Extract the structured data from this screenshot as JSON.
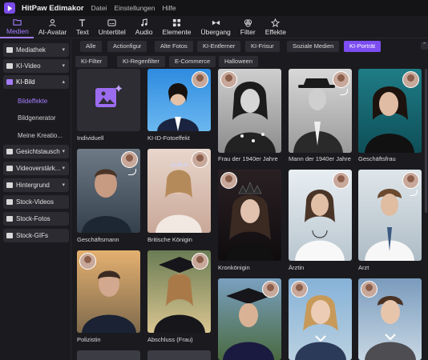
{
  "app": {
    "name": "HitPaw Edimakor",
    "menu": [
      "Datei",
      "Einstellungen",
      "Hilfe"
    ]
  },
  "toolbar": [
    {
      "label": "Medien",
      "icon": "media-folder-icon",
      "active": true
    },
    {
      "label": "AI-Avatar",
      "icon": "avatar-icon"
    },
    {
      "label": "Text",
      "icon": "text-icon"
    },
    {
      "label": "Untertitel",
      "icon": "subtitle-icon"
    },
    {
      "label": "Audio",
      "icon": "music-note-icon"
    },
    {
      "label": "Elemente",
      "icon": "elements-grid-icon"
    },
    {
      "label": "Übergang",
      "icon": "transition-icon"
    },
    {
      "label": "Filter",
      "icon": "filter-icon"
    },
    {
      "label": "Effekte",
      "icon": "effects-star-icon"
    }
  ],
  "sidebar": {
    "items": [
      {
        "label": "Mediathek",
        "icon": "library-icon"
      },
      {
        "label": "KI-Video",
        "icon": "video-icon"
      },
      {
        "label": "KI-Bild",
        "icon": "image-icon",
        "active": true
      },
      {
        "label": "Gesichtstausch",
        "icon": "face-swap-icon"
      },
      {
        "label": "Videoverstärk...",
        "icon": "enhance-icon"
      },
      {
        "label": "Hintergrund",
        "icon": "background-icon"
      },
      {
        "label": "Stock-Videos",
        "icon": "stock-video-icon"
      },
      {
        "label": "Stock-Fotos",
        "icon": "stock-photo-icon"
      },
      {
        "label": "Stock-GIFs",
        "icon": "stock-gif-icon"
      }
    ],
    "subitems": [
      {
        "label": "Bildeffekte",
        "active": true
      },
      {
        "label": "Bildgenerator"
      },
      {
        "label": "Meine Kreatio..."
      }
    ]
  },
  "filters": {
    "row1": [
      "Alle",
      "Actionfigur",
      "Alte Fotos",
      "KI-Entferner",
      "KI-Frisur",
      "Soziale Medien",
      "KI-Porträt"
    ],
    "row2": [
      "KI-Filter",
      "KI-Regenfilter",
      "E-Commerce",
      "Halloween"
    ],
    "active": "KI-Porträt"
  },
  "grid": {
    "col1": [
      "Individuell",
      "Geschäftsmann",
      "Polizistin"
    ],
    "col2": [
      "KI-ID-Fotoeffekt",
      "Britische Königin",
      "Abschluss (Frau)"
    ],
    "col3": [
      "Frau der 1940er Jahre",
      "Kronkönigin"
    ],
    "col4": [
      "Mann der 1940er Jahre",
      "Ärztin"
    ],
    "col5": [
      "Geschäftsfrau",
      "Arzt"
    ]
  },
  "colors": {
    "accent": "#7c4df0",
    "background": "#1b1b1f",
    "panel": "#2c2c32"
  }
}
